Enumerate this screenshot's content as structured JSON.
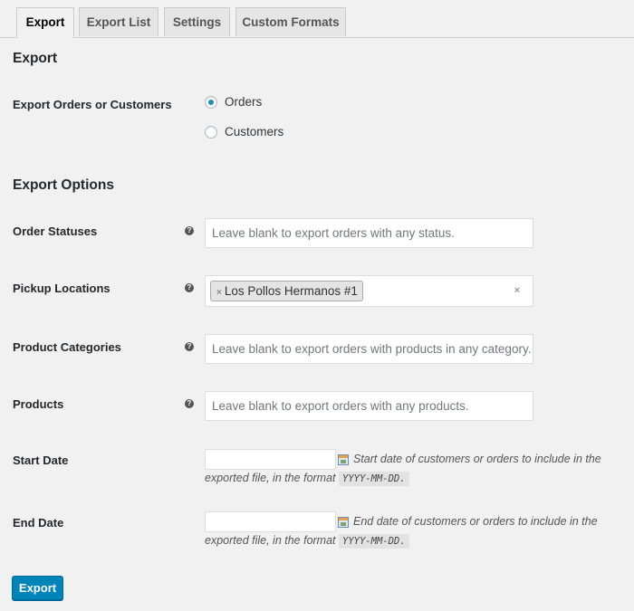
{
  "tabs": [
    {
      "label": "Export",
      "active": true
    },
    {
      "label": "Export List",
      "active": false
    },
    {
      "label": "Settings",
      "active": false
    },
    {
      "label": "Custom Formats",
      "active": false
    }
  ],
  "export_section": {
    "title": "Export",
    "type_label": "Export Orders or Customers",
    "options": [
      {
        "label": "Orders",
        "checked": true
      },
      {
        "label": "Customers",
        "checked": false
      }
    ]
  },
  "options_section": {
    "title": "Export Options",
    "order_statuses": {
      "label": "Order Statuses",
      "placeholder": "Leave blank to export orders with any status."
    },
    "pickup_locations": {
      "label": "Pickup Locations",
      "selected": "Los Pollos Hermanos #1",
      "chip_remove": "×",
      "clear": "×"
    },
    "product_categories": {
      "label": "Product Categories",
      "placeholder": "Leave blank to export orders with products in any category."
    },
    "products": {
      "label": "Products",
      "placeholder": "Leave blank to export orders with any products."
    },
    "start_date": {
      "label": "Start Date",
      "value": "",
      "desc_line1": "Start date of customers or orders to include in the",
      "desc_line2": "exported file, in the format",
      "format": "YYYY-MM-DD."
    },
    "end_date": {
      "label": "End Date",
      "value": "",
      "desc_line1": "End date of customers or orders to include in the",
      "desc_line2": "exported file, in the format",
      "format": "YYYY-MM-DD."
    },
    "help_glyph": "?"
  },
  "submit": {
    "label": "Export",
    "color": "#0085ba"
  }
}
